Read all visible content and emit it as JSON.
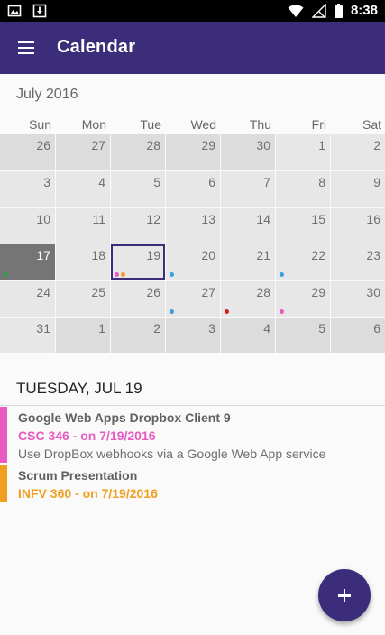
{
  "status_bar": {
    "time": "8:38",
    "left_icons": [
      "image-icon",
      "download-icon"
    ],
    "right_icons": [
      "wifi-icon",
      "signal-icon",
      "battery-icon"
    ]
  },
  "app_bar": {
    "title": "Calendar",
    "menu_icon": "hamburger-menu-icon"
  },
  "calendar": {
    "month_label": "July 2016",
    "weekdays": [
      "Sun",
      "Mon",
      "Tue",
      "Wed",
      "Thu",
      "Fri",
      "Sat"
    ],
    "weeks": [
      [
        {
          "d": "26",
          "other": true
        },
        {
          "d": "27",
          "other": true
        },
        {
          "d": "28",
          "other": true
        },
        {
          "d": "29",
          "other": true
        },
        {
          "d": "30",
          "other": true
        },
        {
          "d": "1"
        },
        {
          "d": "2"
        }
      ],
      [
        {
          "d": "3"
        },
        {
          "d": "4"
        },
        {
          "d": "5"
        },
        {
          "d": "6"
        },
        {
          "d": "7"
        },
        {
          "d": "8"
        },
        {
          "d": "9"
        }
      ],
      [
        {
          "d": "10"
        },
        {
          "d": "11"
        },
        {
          "d": "12"
        },
        {
          "d": "13"
        },
        {
          "d": "14"
        },
        {
          "d": "15"
        },
        {
          "d": "16"
        }
      ],
      [
        {
          "d": "17",
          "today": true,
          "dots": [
            "#2e9e4a"
          ]
        },
        {
          "d": "18"
        },
        {
          "d": "19",
          "selected": true,
          "dots": [
            "#e85cc2",
            "#f0a020"
          ]
        },
        {
          "d": "20",
          "dots": [
            "#3a9de2"
          ]
        },
        {
          "d": "21"
        },
        {
          "d": "22",
          "dots": [
            "#3a9de2"
          ]
        },
        {
          "d": "23"
        }
      ],
      [
        {
          "d": "24"
        },
        {
          "d": "25"
        },
        {
          "d": "26"
        },
        {
          "d": "27",
          "dots": [
            "#3a9de2"
          ]
        },
        {
          "d": "28",
          "dots": [
            "#d81e1e"
          ]
        },
        {
          "d": "29",
          "dots": [
            "#e85cc2"
          ]
        },
        {
          "d": "30"
        }
      ],
      [
        {
          "d": "31"
        },
        {
          "d": "1",
          "other": true
        },
        {
          "d": "2",
          "other": true
        },
        {
          "d": "3",
          "other": true
        },
        {
          "d": "4",
          "other": true
        },
        {
          "d": "5",
          "other": true
        },
        {
          "d": "6",
          "other": true
        }
      ]
    ]
  },
  "events": {
    "header": "TUESDAY, JUL 19",
    "items": [
      {
        "title": "Google Web Apps Dropbox Client 9",
        "course": "CSC 346 - on 7/19/2016",
        "description": "Use DropBox webhooks via a Google Web App service",
        "color": "#e85cc2"
      },
      {
        "title": "Scrum Presentation",
        "course": "INFV 360 - on 7/19/2016",
        "description": "",
        "color": "#f0a020"
      }
    ]
  },
  "fab": {
    "icon": "plus-icon"
  },
  "colors": {
    "primary": "#3b2d7a",
    "today_cell": "#757575"
  }
}
